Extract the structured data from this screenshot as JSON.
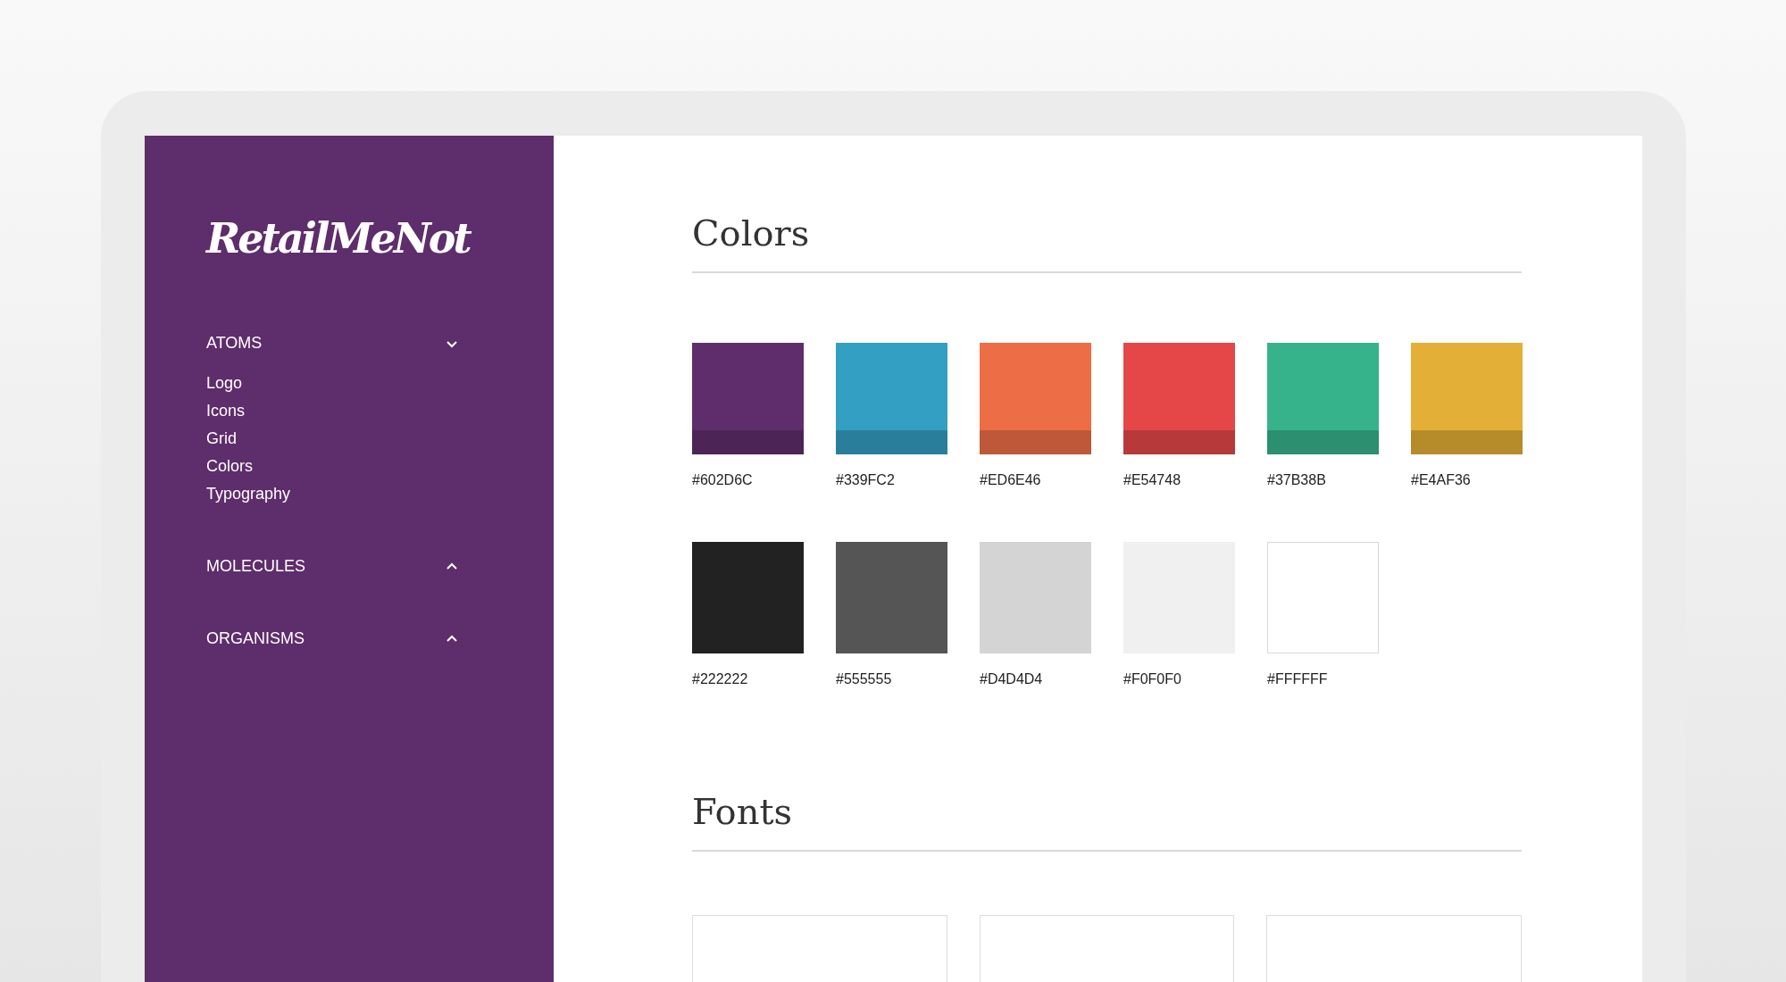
{
  "sidebar": {
    "logo": "RetailMeNot",
    "groups": [
      {
        "label": "ATOMS",
        "expanded": true,
        "items": [
          "Logo",
          "Icons",
          "Grid",
          "Colors",
          "Typography"
        ]
      },
      {
        "label": "MOLECULES",
        "expanded": false
      },
      {
        "label": "ORGANISMS",
        "expanded": false
      }
    ]
  },
  "sections": [
    {
      "title": "Colors",
      "kind": "swatches",
      "swatches": [
        {
          "label": "#602D6C",
          "color": "#602d6c"
        },
        {
          "label": "#339FC2",
          "color": "#339fc2"
        },
        {
          "label": "#ED6E46",
          "color": "#ed6e46"
        },
        {
          "label": "#E54748",
          "color": "#e54748"
        },
        {
          "label": "#37B38B",
          "color": "#37b38b"
        },
        {
          "label": "#E4AF36",
          "color": "#e4af36"
        },
        {
          "label": "#222222",
          "color": "#222222"
        },
        {
          "label": "#555555",
          "color": "#555555"
        },
        {
          "label": "#D4D4D4",
          "color": "#d4d4d4"
        },
        {
          "label": "#F0F0F0",
          "color": "#f0f0f0"
        },
        {
          "label": "#FFFFFF",
          "color": "#ffffff"
        }
      ]
    },
    {
      "title": "Fonts",
      "kind": "cards",
      "cards": [
        {
          "kind": "blank"
        },
        {
          "kind": "blank"
        },
        {
          "kind": "blank"
        }
      ]
    }
  ]
}
